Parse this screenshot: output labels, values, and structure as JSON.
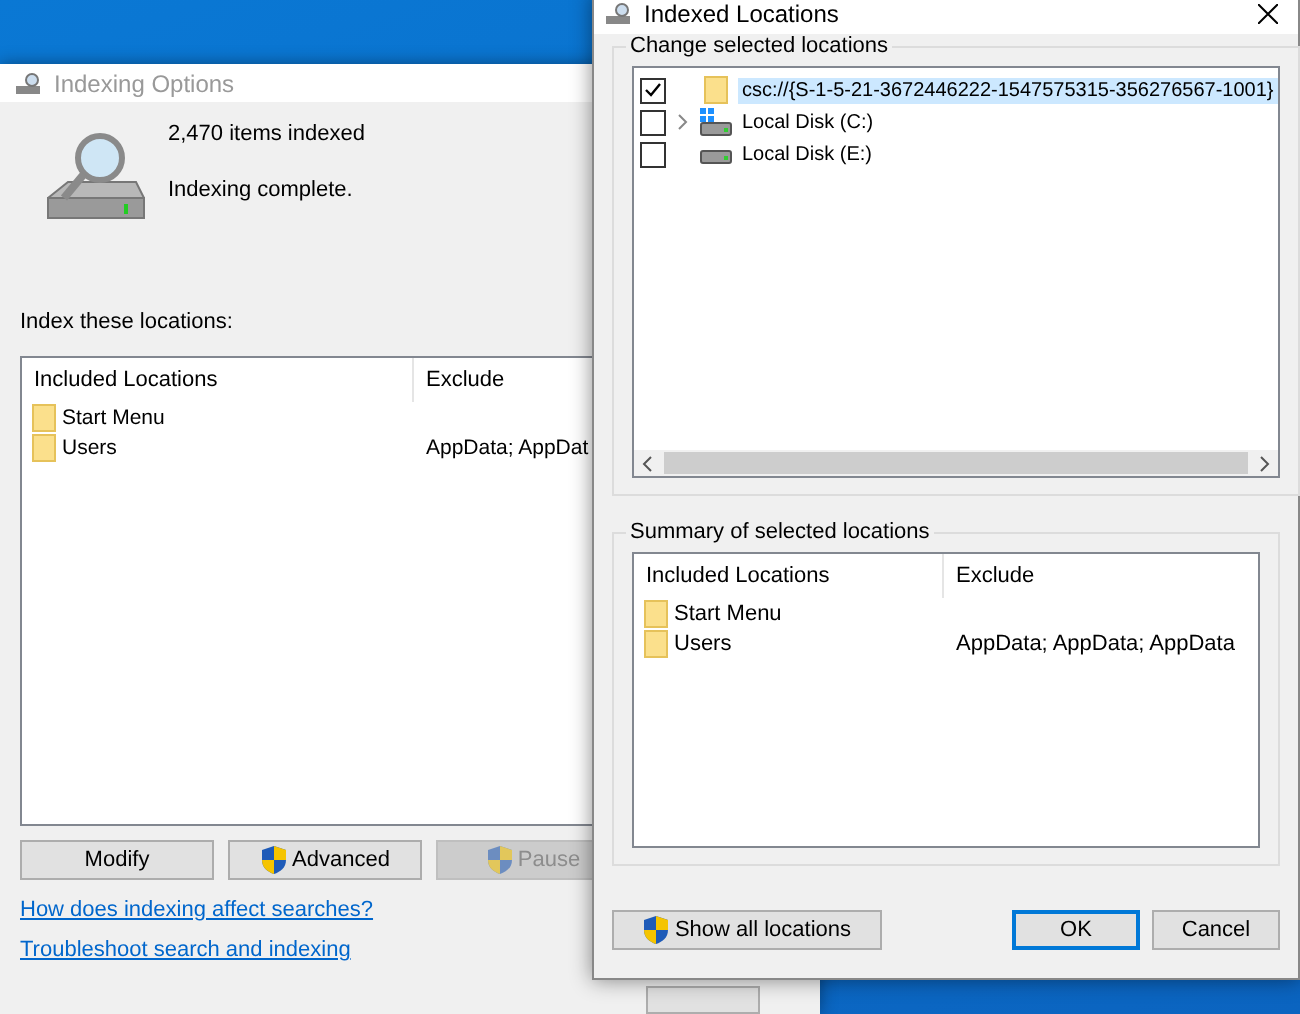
{
  "indexing_options": {
    "title": "Indexing Options",
    "items_indexed": "2,470 items indexed",
    "status": "Indexing complete.",
    "locations_label": "Index these locations:",
    "table": {
      "columns": [
        "Included Locations",
        "Exclude"
      ],
      "rows": [
        {
          "location": "Start Menu"
        },
        {
          "location": "Users",
          "exclude": "AppData; AppDat"
        }
      ]
    },
    "buttons": [
      {
        "label": "Modify",
        "shield": false,
        "disabled": false
      },
      {
        "label": "Advanced",
        "shield": true,
        "disabled": false
      },
      {
        "label": "Pause",
        "shield": true,
        "disabled": true
      }
    ],
    "links": [
      "How does indexing affect searches?",
      "Troubleshoot search and indexing"
    ]
  },
  "indexed_locations": {
    "title": "Indexed Locations",
    "change_group": {
      "title": "Change selected locations",
      "items": [
        {
          "label": "csc://{S-1-5-21-3672446222-1547575315-356276567-1001}",
          "kind": "folder",
          "checked": true,
          "selected": true,
          "expandable": false
        },
        {
          "label": "Local Disk (C:)",
          "kind": "system-drive",
          "checked": false,
          "selected": false,
          "expandable": true
        },
        {
          "label": "Local Disk (E:)",
          "kind": "drive",
          "checked": false,
          "selected": false,
          "expandable": false
        }
      ]
    },
    "summary_group": {
      "title": "Summary of selected locations",
      "columns": [
        "Included Locations",
        "Exclude"
      ],
      "rows": [
        {
          "location": "Start Menu"
        },
        {
          "location": "Users",
          "exclude": "AppData; AppData; AppData"
        }
      ]
    },
    "buttons": [
      {
        "label": "Show all locations",
        "shield": true,
        "default": false
      },
      {
        "label": "OK",
        "shield": false,
        "default": true
      },
      {
        "label": "Cancel",
        "shield": false,
        "default": false
      }
    ]
  }
}
